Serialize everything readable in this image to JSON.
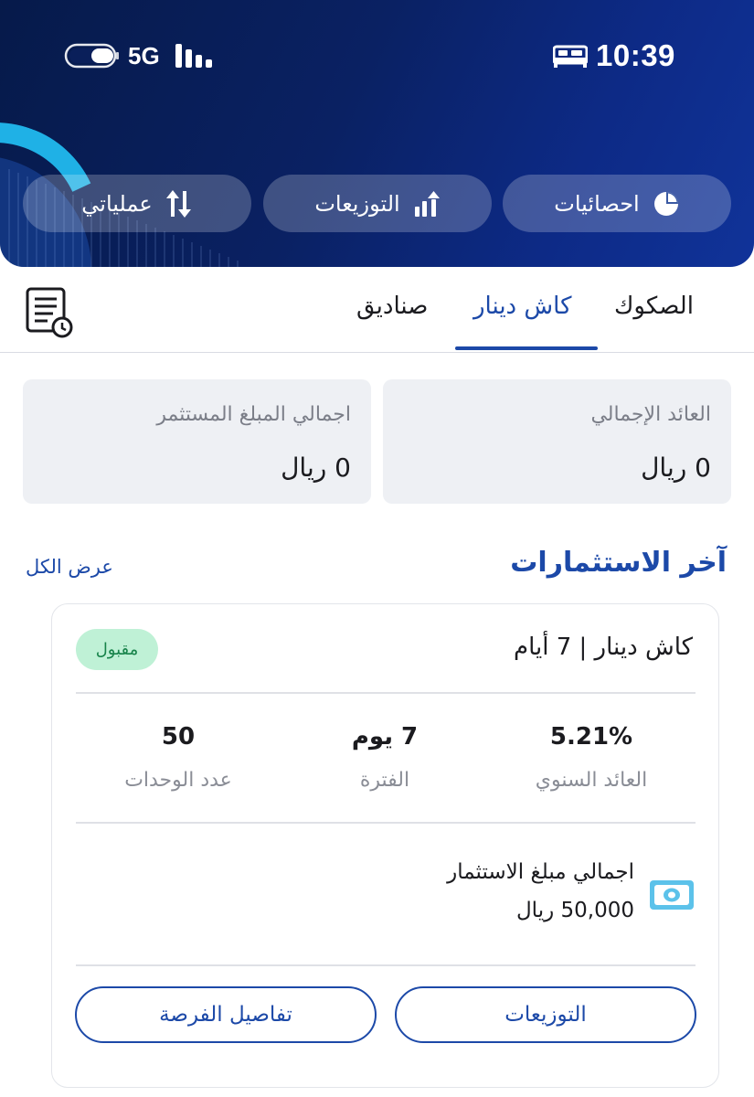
{
  "status_bar": {
    "time": "10:39",
    "network": "5G",
    "icons": [
      "toggle-icon",
      "signal-icon",
      "bed-icon"
    ]
  },
  "quick_actions": [
    {
      "label": "احصائيات",
      "icon": "pie-chart-icon"
    },
    {
      "label": "التوزيعات",
      "icon": "bar-chart-up-icon"
    },
    {
      "label": "عملياتي",
      "icon": "swap-arrows-icon"
    }
  ],
  "tabs": [
    {
      "label": "الصكوك",
      "active": false
    },
    {
      "label": "كاش دينار",
      "active": true
    },
    {
      "label": "صناديق",
      "active": false
    }
  ],
  "summary": {
    "total_return": {
      "label": "العائد الإجمالي",
      "value": "0 ريال"
    },
    "total_invested": {
      "label": "اجمالي المبلغ المستثمر",
      "value": "0 ريال"
    }
  },
  "latest": {
    "title": "آخر الاستثمارات",
    "view_all": "عرض الكل"
  },
  "investment": {
    "title": "كاش دينار | 7 أيام",
    "status": "مقبول",
    "annual_yield": {
      "value": "5.21%",
      "label": "العائد السنوي"
    },
    "period": {
      "value": "7 يوم",
      "label": "الفترة"
    },
    "units": {
      "value": "50",
      "label": "عدد الوحدات"
    },
    "amount_label": "اجمالي مبلغ الاستثمار",
    "amount_value": "50,000 ريال",
    "distributions_button": "التوزيعات",
    "details_button": "تفاصيل الفرصة"
  },
  "colors": {
    "primary": "#1c49a8",
    "header_dark": "#061a4a",
    "accent_cyan": "#1fb1e6",
    "badge_bg": "#bff1d6",
    "badge_text": "#17834a"
  }
}
